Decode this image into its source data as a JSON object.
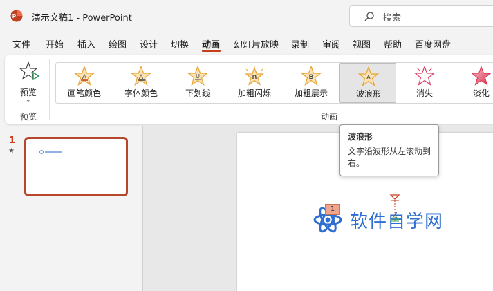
{
  "window": {
    "title": "演示文稿1  -  PowerPoint"
  },
  "search": {
    "placeholder": "搜索"
  },
  "tabs": [
    {
      "label": "文件"
    },
    {
      "label": "开始"
    },
    {
      "label": "插入"
    },
    {
      "label": "绘图"
    },
    {
      "label": "设计"
    },
    {
      "label": "切换"
    },
    {
      "label": "动画",
      "active": true
    },
    {
      "label": "幻灯片放映"
    },
    {
      "label": "录制"
    },
    {
      "label": "审阅"
    },
    {
      "label": "视图"
    },
    {
      "label": "帮助"
    },
    {
      "label": "百度网盘"
    }
  ],
  "ribbon": {
    "preview_label": "预览",
    "preview_group": "预览",
    "animation_group": "动画",
    "animations": [
      {
        "label": "画笔颜色",
        "icon": "pen-color-star-icon",
        "letter": "A"
      },
      {
        "label": "字体颜色",
        "icon": "font-color-star-icon",
        "letter": "A"
      },
      {
        "label": "下划线",
        "icon": "underline-star-icon",
        "letter": "U"
      },
      {
        "label": "加粗闪烁",
        "icon": "bold-flash-star-icon",
        "letter": "B"
      },
      {
        "label": "加粗展示",
        "icon": "bold-reveal-star-icon",
        "letter": "B"
      },
      {
        "label": "波浪形",
        "icon": "wave-star-icon",
        "letter": "A",
        "selected": true
      },
      {
        "label": "消失",
        "icon": "disappear-star-icon"
      },
      {
        "label": "淡化",
        "icon": "fade-star-icon"
      }
    ]
  },
  "tooltip": {
    "title": "波浪形",
    "description": "文字沿波形从左滚动到右。"
  },
  "slides": [
    {
      "number": "1"
    }
  ],
  "slide": {
    "logo_text": "软件自学网",
    "animation_tag": "1"
  },
  "colors": {
    "accent": "#c43e1c",
    "gold": "#e8a436",
    "logo_blue": "#2f6fd1"
  }
}
